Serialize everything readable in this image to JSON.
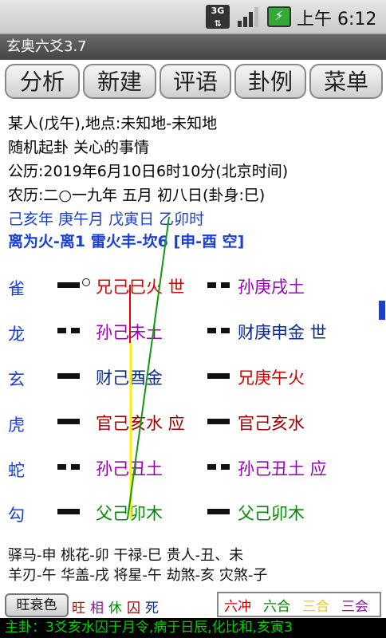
{
  "status": {
    "network": "3G",
    "time": "上午 6:12"
  },
  "app": {
    "title": "玄奥六爻3.7"
  },
  "tabs": [
    "分析",
    "新建",
    "评语",
    "卦例",
    "菜单"
  ],
  "info": {
    "person": "某人(戊午),地点:未知地-未知地",
    "question": "随机起卦  关心的事情",
    "solar": "公历:2019年6月10日6时10分(北京时间)",
    "lunar": "农历:二○一九年 五月 初八日(卦身:巳)",
    "ganzhi": "己亥年  庚午月  戊寅日  乙卯时",
    "gua": "离为火-离1  雷火丰-坎6 [申-酉 空]"
  },
  "animals": [
    "雀",
    "龙",
    "玄",
    "虎",
    "蛇",
    "勾"
  ],
  "yao": [
    {
      "left_type": "yang-moving",
      "left": "兄己巳火 世",
      "left_color": "#d40000",
      "right_type": "yin",
      "right": "孙庚戌土",
      "right_color": "#9a00b5"
    },
    {
      "left_type": "yin",
      "left": "孙己未土",
      "left_color": "#9a00b5",
      "right_type": "yin",
      "right": "财庚申金 世",
      "right_color": "#0a2a90"
    },
    {
      "left_type": "yang",
      "left": "财己酉金",
      "left_color": "#0a2a90",
      "right_type": "yang",
      "right": "兄庚午火",
      "right_color": "#d40000"
    },
    {
      "left_type": "yang",
      "left": "官己亥水 应",
      "left_color": "#a00000",
      "right_type": "yang",
      "right": "官己亥水",
      "right_color": "#a00000"
    },
    {
      "left_type": "yin",
      "left": "孙己丑土",
      "left_color": "#9a00b5",
      "right_type": "yin",
      "right": "孙己丑土 应",
      "right_color": "#9a00b5"
    },
    {
      "left_type": "yang",
      "left": "父己卯木",
      "left_color": "#008a00",
      "right_type": "yang",
      "right": "父己卯木",
      "right_color": "#008a00"
    }
  ],
  "shensha": {
    "row1": "驿马-申   桃花-卯    干禄-巳    贵人-丑、未",
    "row2": "羊刃-午   华盖-戌    将星-午    劫煞-亥    灾煞-子"
  },
  "wangshuai": {
    "button": "旺衰色",
    "states": [
      {
        "label": "旺",
        "color": "#d40000"
      },
      {
        "label": "相",
        "color": "#9a00b5"
      },
      {
        "label": "休",
        "color": "#008a00"
      },
      {
        "label": "囚",
        "color": "#a00000"
      },
      {
        "label": "死",
        "color": "#0a2a90"
      }
    ]
  },
  "legend": [
    {
      "label": "六冲",
      "color": "#d40000"
    },
    {
      "label": "六合",
      "color": "#008a00"
    },
    {
      "label": "三合",
      "color": "#e8d000"
    },
    {
      "label": "三会",
      "color": "#9a00b5"
    }
  ],
  "footer": "主卦：3爻亥水囚于月令,病于日辰,化比和,亥寅3"
}
